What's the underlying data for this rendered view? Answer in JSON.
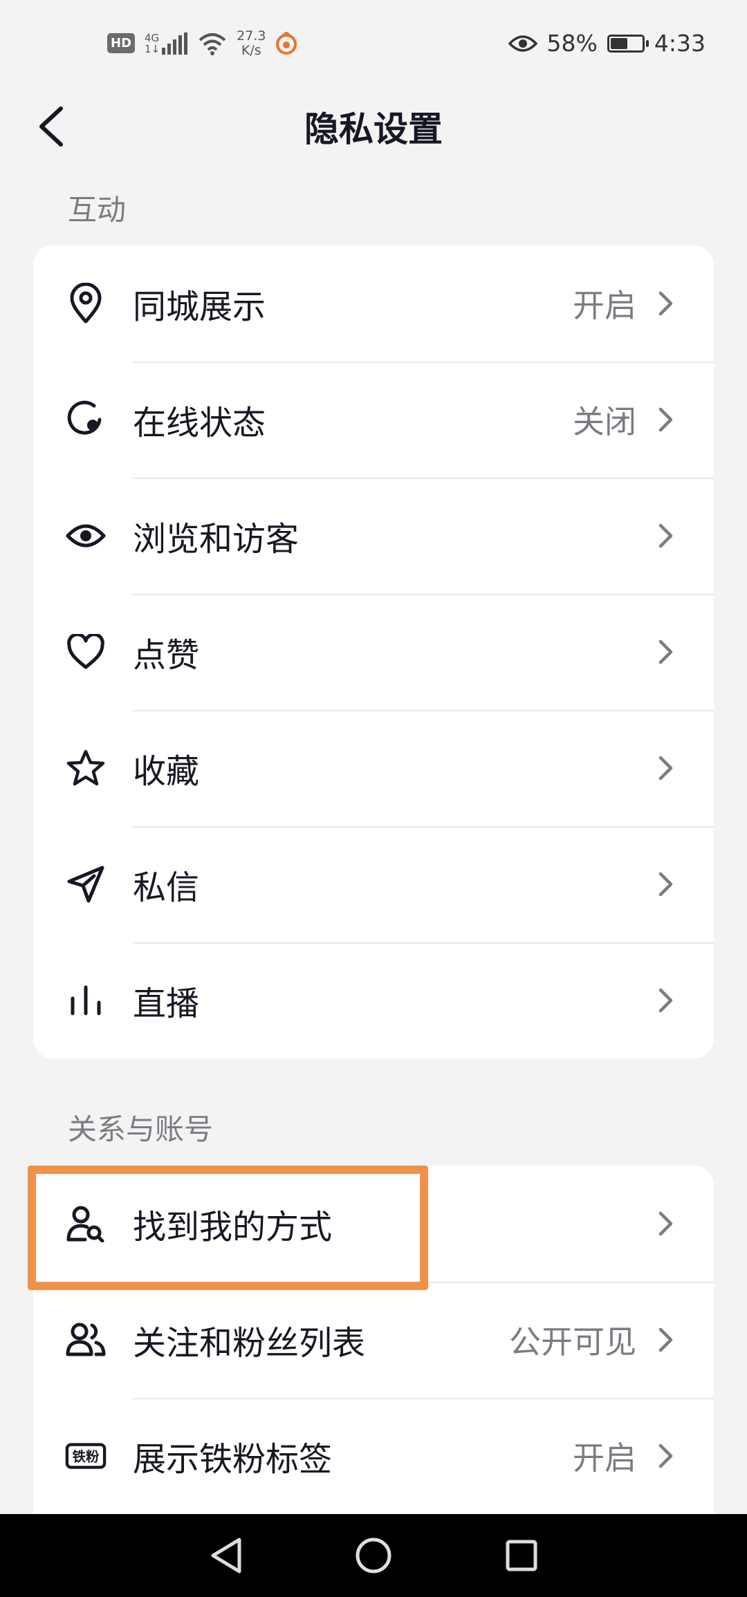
{
  "status_bar": {
    "hd": "HD",
    "network": "4G",
    "network_sub": "1↓",
    "speed_value": "27.3",
    "speed_unit": "K/s",
    "battery_percent": "58%",
    "battery_level": 0.58,
    "time": "4:33"
  },
  "header": {
    "title": "隐私设置"
  },
  "sections": [
    {
      "title": "互动",
      "items": [
        {
          "label": "同城展示",
          "value": "开启",
          "icon": "location-pin-icon"
        },
        {
          "label": "在线状态",
          "value": "关闭",
          "icon": "online-status-icon"
        },
        {
          "label": "浏览和访客",
          "value": "",
          "icon": "eye-icon"
        },
        {
          "label": "点赞",
          "value": "",
          "icon": "heart-icon"
        },
        {
          "label": "收藏",
          "value": "",
          "icon": "star-icon"
        },
        {
          "label": "私信",
          "value": "",
          "icon": "paper-plane-icon"
        },
        {
          "label": "直播",
          "value": "",
          "icon": "live-bars-icon"
        }
      ]
    },
    {
      "title": "关系与账号",
      "items": [
        {
          "label": "找到我的方式",
          "value": "",
          "icon": "user-search-icon"
        },
        {
          "label": "关注和粉丝列表",
          "value": "公开可见",
          "icon": "users-icon"
        },
        {
          "label": "展示铁粉标签",
          "value": "开启",
          "icon": "fan-badge-icon"
        }
      ]
    }
  ],
  "badge_icon_text": "铁粉",
  "colors": {
    "highlight": "#f0914a",
    "background": "#f3f3f3",
    "text_primary": "#161823",
    "text_secondary": "#7a7c83"
  }
}
